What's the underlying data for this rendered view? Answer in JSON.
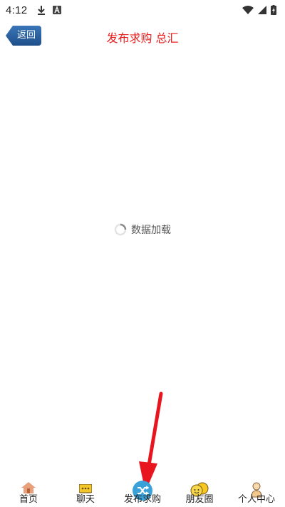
{
  "status_bar": {
    "time": "4:12",
    "icons": [
      "download-icon",
      "app-notification-icon",
      "wifi-icon",
      "signal-icon",
      "battery-charging-icon"
    ]
  },
  "header": {
    "back_label": "返回",
    "title": "发布求购 总汇"
  },
  "loading": {
    "text": "数据加载"
  },
  "bottom_nav": {
    "items": [
      {
        "label": "首页",
        "icon": "home-icon"
      },
      {
        "label": "聊天",
        "icon": "chat-icon"
      },
      {
        "label": "发布求购",
        "icon": "shuffle-icon"
      },
      {
        "label": "朋友圈",
        "icon": "friends-icon"
      },
      {
        "label": "个人中心",
        "icon": "user-icon"
      }
    ]
  },
  "colors": {
    "title": "#e61e1e",
    "back_button": "#2a5f9e",
    "arrow": "#e8141e",
    "accent_nav": "#3aa0d8"
  }
}
